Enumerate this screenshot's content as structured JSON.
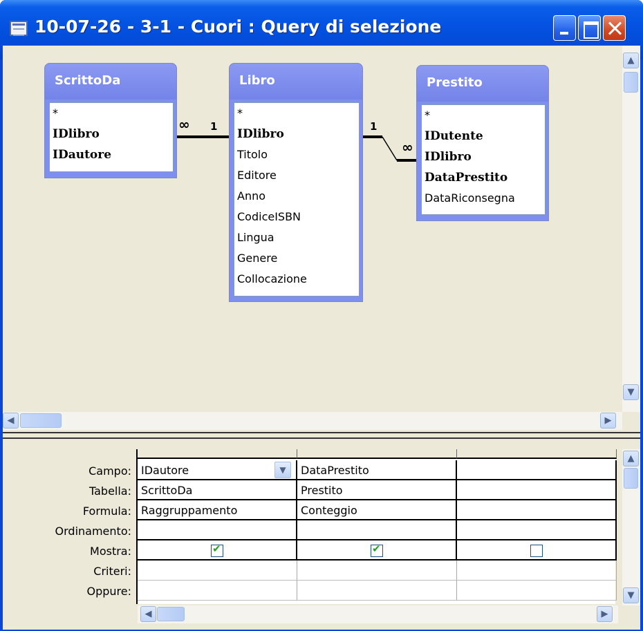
{
  "window": {
    "title": "10-07-26 - 3-1 - Cuori : Query di selezione"
  },
  "tables": [
    {
      "name": "ScrittoDa",
      "fields": [
        "*",
        "IDlibro",
        "IDautore"
      ],
      "key_fields": [
        1,
        2
      ]
    },
    {
      "name": "Libro",
      "fields": [
        "*",
        "IDlibro",
        "Titolo",
        "Editore",
        "Anno",
        "CodiceISBN",
        "Lingua",
        "Genere",
        "Collocazione"
      ],
      "key_fields": [
        1
      ]
    },
    {
      "name": "Prestito",
      "fields": [
        "*",
        "IDutente",
        "IDlibro",
        "DataPrestito",
        "DataRiconsegna"
      ],
      "key_fields": [
        1,
        2,
        3
      ]
    }
  ],
  "relations": {
    "scrittoda_libro": {
      "left": "∞",
      "right": "1"
    },
    "libro_prestito": {
      "left": "1",
      "right": "∞"
    }
  },
  "grid": {
    "row_labels": [
      "Campo:",
      "Tabella:",
      "Formula:",
      "Ordinamento:",
      "Mostra:",
      "Criteri:",
      "Oppure:"
    ],
    "columns": [
      {
        "campo": "IDautore",
        "tabella": "ScrittoDa",
        "formula": "Raggruppamento",
        "ordinamento": "",
        "mostra": true,
        "criteri": "",
        "oppure": ""
      },
      {
        "campo": "DataPrestito",
        "tabella": "Prestito",
        "formula": "Conteggio",
        "ordinamento": "",
        "mostra": true,
        "criteri": "",
        "oppure": ""
      },
      {
        "campo": "",
        "tabella": "",
        "formula": "",
        "ordinamento": "",
        "mostra": false,
        "criteri": "",
        "oppure": ""
      }
    ]
  },
  "icons": {
    "window": "query-window-icon",
    "minimize": "minimize-icon",
    "maximize": "maximize-icon",
    "close": "close-icon"
  },
  "colors": {
    "titlebar": "#0553e2",
    "table_header": "#7f8ff0",
    "client": "#ece9d8"
  }
}
